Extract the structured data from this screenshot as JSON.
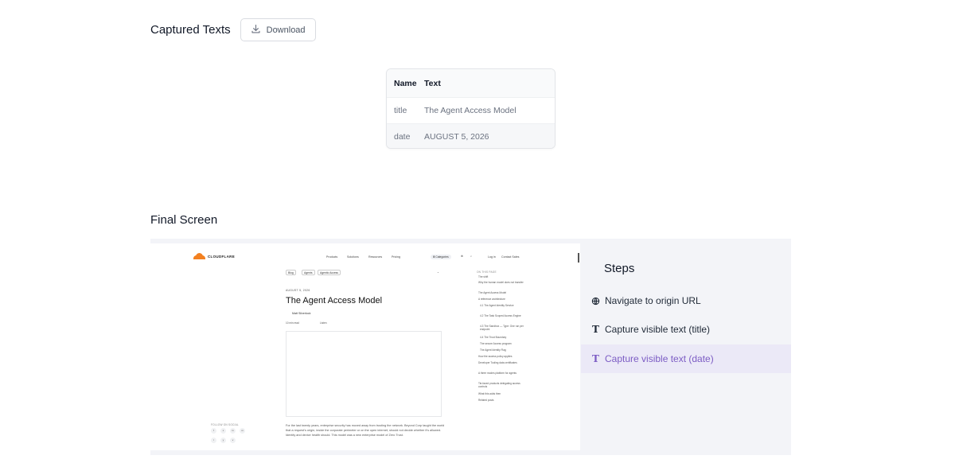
{
  "captured": {
    "title": "Captured Texts",
    "download_label": "Download",
    "table": {
      "headers": [
        "Name",
        "Text"
      ],
      "rows": [
        {
          "name": "title",
          "text": "The Agent Access Model"
        },
        {
          "name": "date",
          "text": "AUGUST 5, 2026"
        }
      ]
    }
  },
  "final_screen": {
    "title": "Final Screen",
    "screenshot": {
      "logo_text": "CLOUDFLARE",
      "nav": [
        "Products",
        "Solutions",
        "Resources",
        "Pricing"
      ],
      "lang": "Ⅲ Categories",
      "nav_right": [
        "Log in",
        "Contact Sales"
      ],
      "breadcrumb": [
        "Blog",
        "Agents",
        "Agentic Access"
      ],
      "post_date": "AUGUST 5, 2026",
      "post_title": "The Agent Access Model",
      "author": "Matt Silverlock",
      "meta": [
        "10 min read",
        "Listen"
      ],
      "paragraph": "For the last twenty years, enterprise security has moved away from trusting the network. Beyond Corp taught the world that a request's origin, inside the corporate perimeter or on the open internet, should not decide whether it's allowed. Identity and device health should. This model was a new enterprise model of Zero Trust.",
      "follow_label": "FOLLOW ON SOCIAL",
      "toc_head": "ON THIS PAGE",
      "toc": [
        "The shift",
        "Why the human model does not transfer",
        "The Agent Access Model",
        "A reference architecture",
        "4.1 The Agent Identity Service",
        "4.2 The Task Scoped Access Engine",
        "4.3 The Sandbox — Type: One run per endpoint",
        "4.4 The Trust Boundary",
        "The secure Access program",
        "The Agent Identity Flag",
        "How the access policy applies",
        "Developer Tooling data certificates",
        "A three modes platform for agents",
        "Tie-faced products delegating access controls",
        "What this adds then",
        "Related posts"
      ]
    },
    "steps": {
      "title": "Steps",
      "items": [
        {
          "label": "Navigate to origin URL",
          "icon": "globe-icon",
          "active": false
        },
        {
          "label": "Capture visible text (title)",
          "icon": "text-icon",
          "active": false
        },
        {
          "label": "Capture visible text (date)",
          "icon": "text-icon",
          "active": true
        }
      ]
    }
  },
  "colors": {
    "accent": "#7c5cc4",
    "active_bg": "#ebe9f7",
    "panel_bg": "#f3f4f8",
    "brand_orange": "#f38020"
  }
}
